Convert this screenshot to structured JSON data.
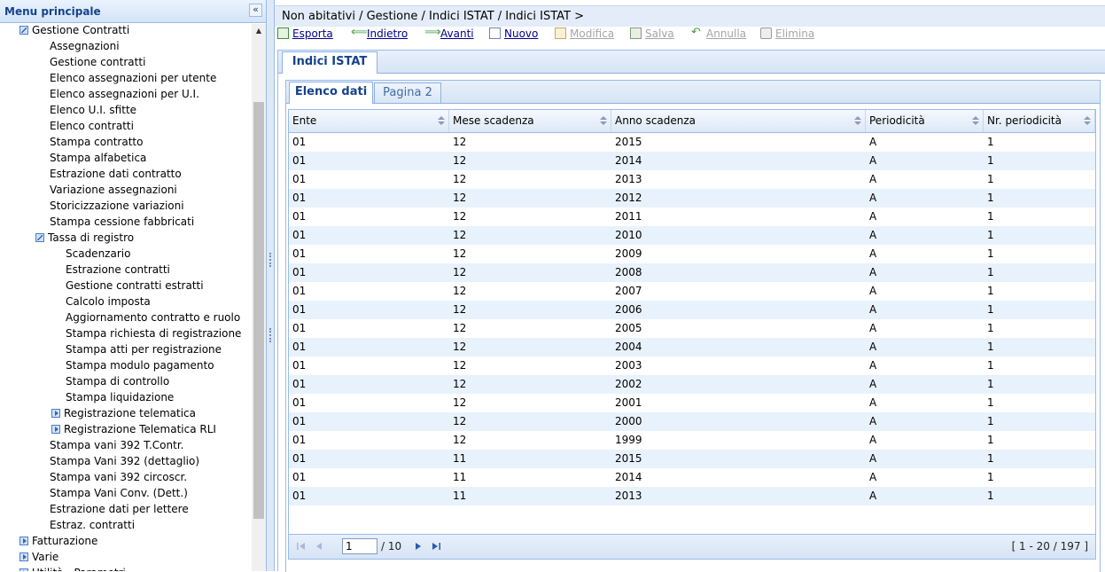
{
  "sidebar": {
    "title": "Menu principale",
    "collapse_glyph": "«",
    "tree": [
      {
        "label": "Gestione Contratti",
        "level": 1,
        "icon": "open"
      },
      {
        "label": "Assegnazioni",
        "level": 2
      },
      {
        "label": "Gestione contratti",
        "level": 2
      },
      {
        "label": "Elenco assegnazioni per utente",
        "level": 2
      },
      {
        "label": "Elenco assegnazioni per U.I.",
        "level": 2
      },
      {
        "label": "Elenco U.I. sfitte",
        "level": 2
      },
      {
        "label": "Elenco contratti",
        "level": 2
      },
      {
        "label": "Stampa contratto",
        "level": 2
      },
      {
        "label": "Stampa alfabetica",
        "level": 2
      },
      {
        "label": "Estrazione dati contratto",
        "level": 2
      },
      {
        "label": "Variazione assegnazioni",
        "level": 2
      },
      {
        "label": "Storicizzazione variazioni",
        "level": 2
      },
      {
        "label": "Stampa cessione fabbricati",
        "level": 2
      },
      {
        "label": "Tassa di registro",
        "level": 2,
        "icon": "open"
      },
      {
        "label": "Scadenzario",
        "level": 3
      },
      {
        "label": "Estrazione contratti",
        "level": 3
      },
      {
        "label": "Gestione contratti estratti",
        "level": 3
      },
      {
        "label": "Calcolo imposta",
        "level": 3
      },
      {
        "label": "Aggiornamento contratto e ruolo",
        "level": 3
      },
      {
        "label": "Stampa richiesta di registrazione",
        "level": 3
      },
      {
        "label": "Stampa atti per registrazione",
        "level": 3
      },
      {
        "label": "Stampa modulo pagamento",
        "level": 3
      },
      {
        "label": "Stampa di controllo",
        "level": 3
      },
      {
        "label": "Stampa liquidazione",
        "level": 3
      },
      {
        "label": "Registrazione telematica",
        "level": 3,
        "icon": "closed"
      },
      {
        "label": "Registrazione Telematica RLI",
        "level": 3,
        "icon": "closed"
      },
      {
        "label": "Stampa vani 392 T.Contr.",
        "level": 2
      },
      {
        "label": "Stampa Vani 392 (dettaglio)",
        "level": 2
      },
      {
        "label": "Stampa vani 392 circoscr.",
        "level": 2
      },
      {
        "label": "Stampa Vani Conv. (Dett.)",
        "level": 2
      },
      {
        "label": "Estrazione dati per lettere",
        "level": 2
      },
      {
        "label": "Estraz. contratti",
        "level": 2
      },
      {
        "label": "Fatturazione",
        "level": 1,
        "icon": "closed"
      },
      {
        "label": "Varie",
        "level": 1,
        "icon": "closed"
      },
      {
        "label": "Utilità - Parametri",
        "level": 1,
        "icon": "closed"
      }
    ]
  },
  "breadcrumb": "Non abitativi / Gestione / Indici ISTAT / Indici ISTAT >",
  "toolbar": {
    "esporta": "Esporta",
    "indietro": "Indietro",
    "avanti": "Avanti",
    "nuovo": "Nuovo",
    "modifica": "Modifica",
    "salva": "Salva",
    "annulla": "Annulla",
    "elimina": "Elimina"
  },
  "outer_tab": "Indici ISTAT",
  "inner_tabs": {
    "elenco": "Elenco dati",
    "pagina2": "Pagina 2"
  },
  "grid": {
    "columns": [
      "Ente",
      "Mese scadenza",
      "Anno scadenza",
      "Periodicità",
      "Nr. periodicità"
    ],
    "rows": [
      [
        "01",
        "12",
        "2015",
        "A",
        "1"
      ],
      [
        "01",
        "12",
        "2014",
        "A",
        "1"
      ],
      [
        "01",
        "12",
        "2013",
        "A",
        "1"
      ],
      [
        "01",
        "12",
        "2012",
        "A",
        "1"
      ],
      [
        "01",
        "12",
        "2011",
        "A",
        "1"
      ],
      [
        "01",
        "12",
        "2010",
        "A",
        "1"
      ],
      [
        "01",
        "12",
        "2009",
        "A",
        "1"
      ],
      [
        "01",
        "12",
        "2008",
        "A",
        "1"
      ],
      [
        "01",
        "12",
        "2007",
        "A",
        "1"
      ],
      [
        "01",
        "12",
        "2006",
        "A",
        "1"
      ],
      [
        "01",
        "12",
        "2005",
        "A",
        "1"
      ],
      [
        "01",
        "12",
        "2004",
        "A",
        "1"
      ],
      [
        "01",
        "12",
        "2003",
        "A",
        "1"
      ],
      [
        "01",
        "12",
        "2002",
        "A",
        "1"
      ],
      [
        "01",
        "12",
        "2001",
        "A",
        "1"
      ],
      [
        "01",
        "12",
        "2000",
        "A",
        "1"
      ],
      [
        "01",
        "12",
        "1999",
        "A",
        "1"
      ],
      [
        "01",
        "11",
        "2015",
        "A",
        "1"
      ],
      [
        "01",
        "11",
        "2014",
        "A",
        "1"
      ],
      [
        "01",
        "11",
        "2013",
        "A",
        "1"
      ]
    ]
  },
  "pager": {
    "current_page": "1",
    "total_pages": "/ 10",
    "record_count": "[ 1 - 20 / 197 ]"
  },
  "colors": {
    "accent": "#15428b",
    "link": "#00008b",
    "disabled": "#a5a5a5",
    "row_alt": "#e8f2fc"
  }
}
